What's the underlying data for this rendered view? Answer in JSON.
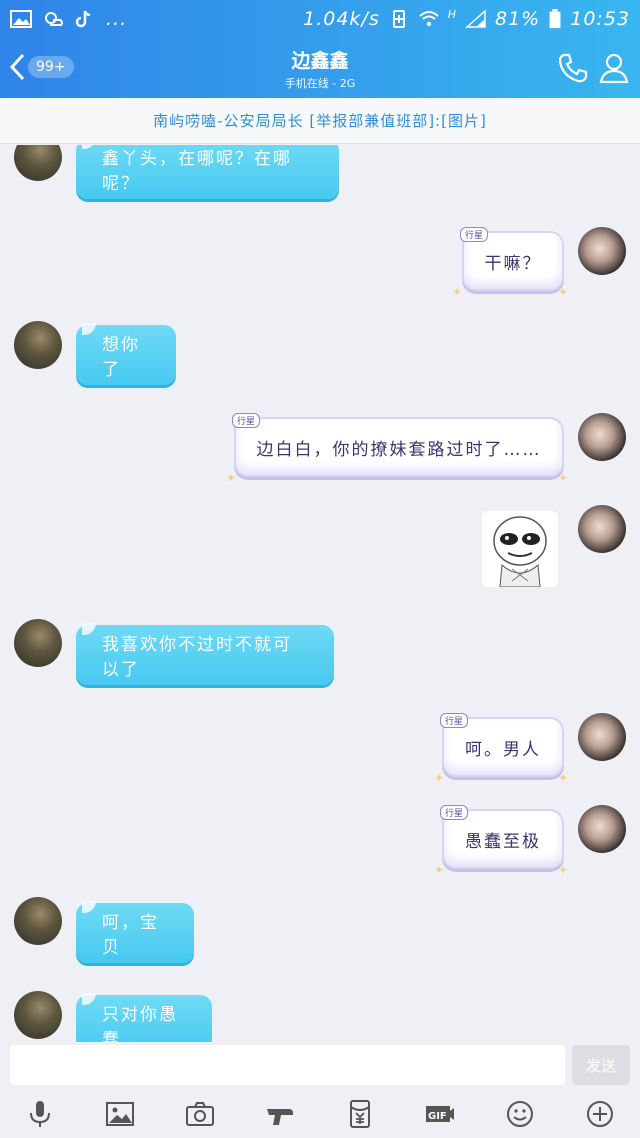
{
  "status_bar": {
    "network_speed": "1.04k/s",
    "battery": "81%",
    "time": "10:53",
    "signal_label": "H",
    "more": "..."
  },
  "header": {
    "back_badge": "99+",
    "title": "边鑫鑫",
    "subtitle": "手机在线 - 2G"
  },
  "notice": "南屿唠嗑-公安局局长 [举报部兼值班部]:[图片]",
  "messages": [
    {
      "side": "in",
      "text": "鑫丫头，在哪呢？在哪呢？"
    },
    {
      "side": "out",
      "text": "干嘛？",
      "tag": "行星"
    },
    {
      "side": "in",
      "text": "想你了"
    },
    {
      "side": "out",
      "text": "边白白，你的撩妹套路过时了……",
      "tag": "行星"
    },
    {
      "side": "out",
      "type": "sticker",
      "sticker": "rage-face-sticker"
    },
    {
      "side": "in",
      "text": "我喜欢你不过时不就可以了"
    },
    {
      "side": "out",
      "text": "呵。男人",
      "tag": "行星"
    },
    {
      "side": "out",
      "text": "愚蠢至极",
      "tag": "行星"
    },
    {
      "side": "in",
      "text": "呵，宝贝"
    },
    {
      "side": "in",
      "text": "只对你愚蠢"
    }
  ],
  "input": {
    "placeholder": "",
    "send_label": "发送"
  },
  "toolbar": [
    "mic-icon",
    "image-icon",
    "camera-icon",
    "hongbao-gun-icon",
    "red-packet-icon",
    "gif-icon",
    "emoji-icon",
    "plus-icon"
  ],
  "colors": {
    "header": "#2f84e8",
    "bubble_in": "#47c9f0",
    "bubble_out_border": "#d8d4f2",
    "notice_text": "#2f8fd6"
  }
}
